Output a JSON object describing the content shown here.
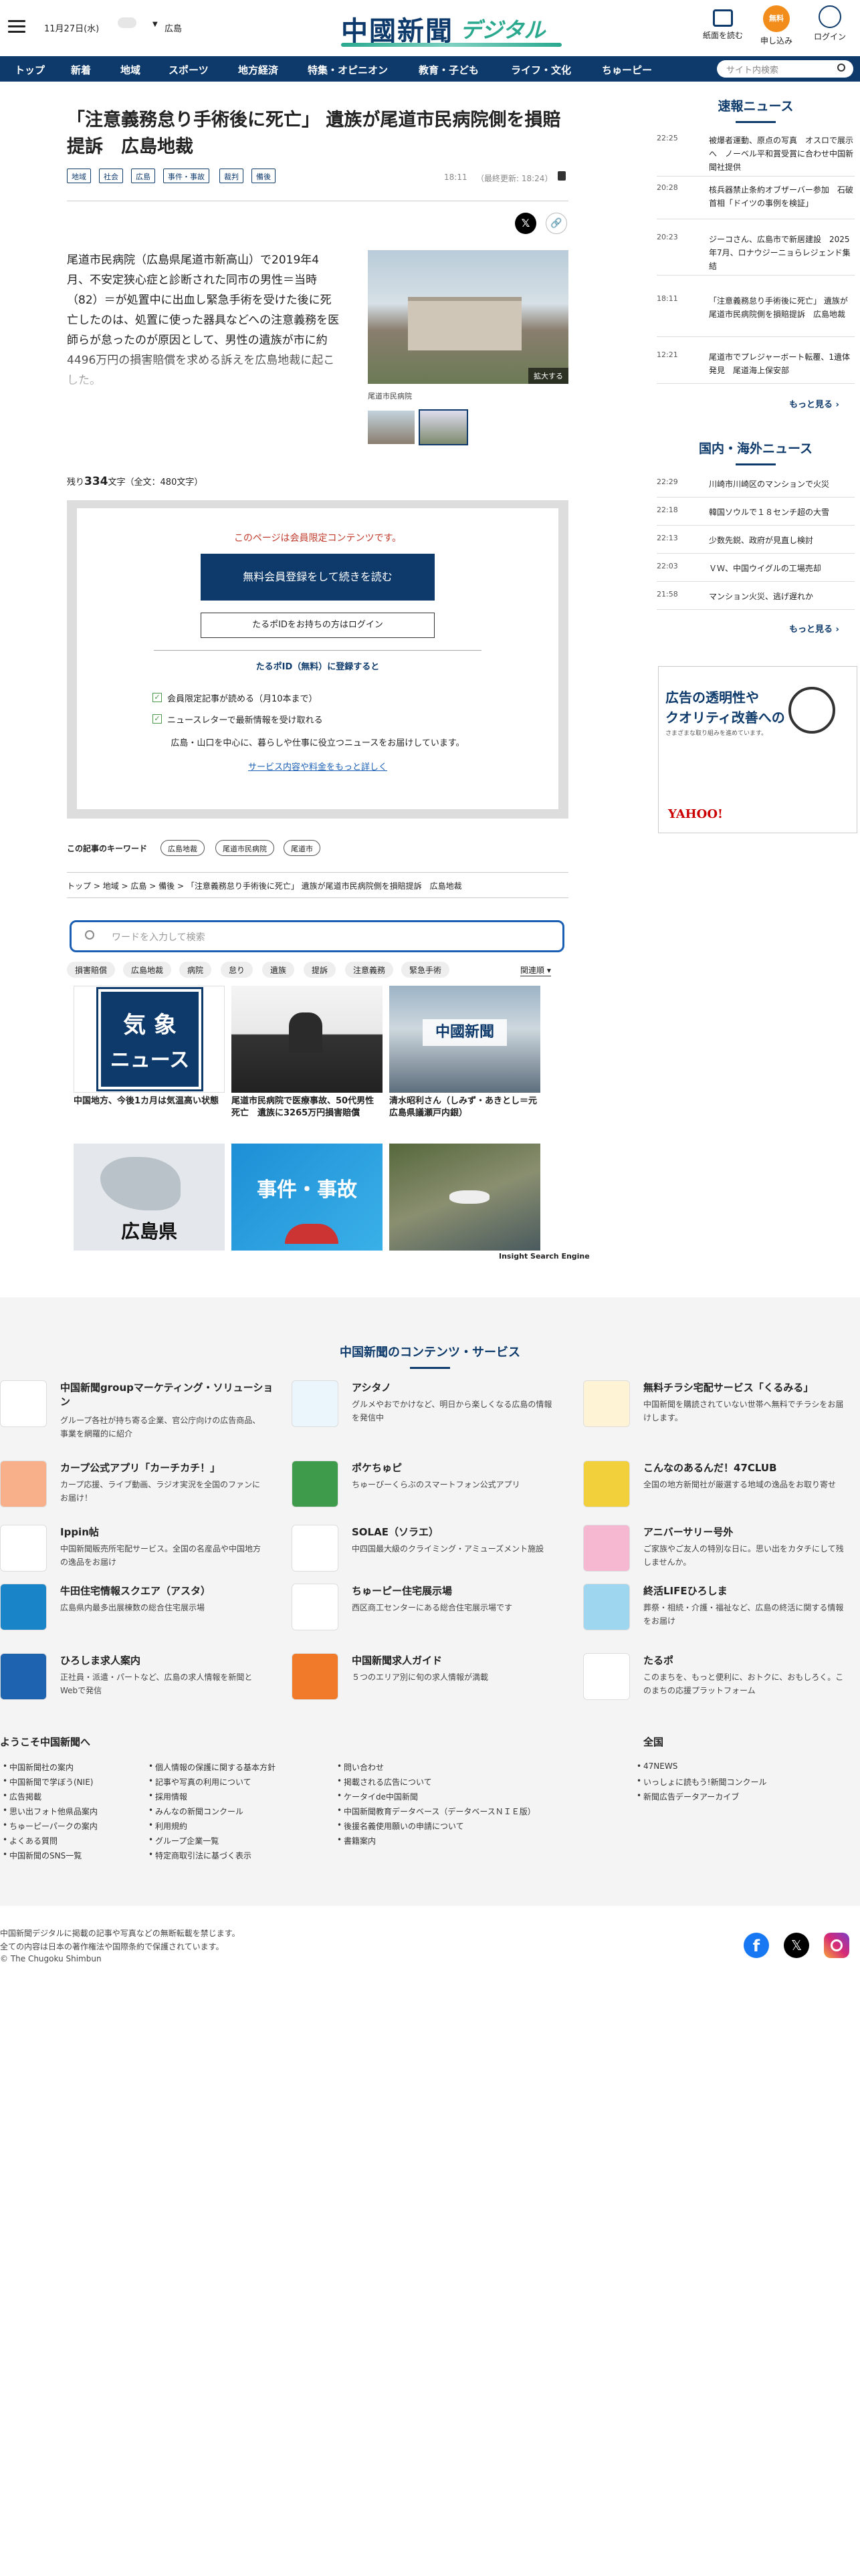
{
  "header": {
    "date": "11月27日(水)",
    "region": "広島",
    "logo_main": "中國新聞",
    "logo_sub": "デジタル",
    "buttons": [
      {
        "label": "紙面を読む",
        "icon": "newspaper-icon"
      },
      {
        "label": "申し込み",
        "icon": "free-badge-icon",
        "badge": "無料"
      },
      {
        "label": "ログイン",
        "icon": "login-icon"
      }
    ]
  },
  "nav": {
    "items": [
      "トップ",
      "新着",
      "地域",
      "スポーツ",
      "地方経済",
      "特集・オピニオン",
      "教育・子ども",
      "ライフ・文化",
      "ちゅーピー"
    ],
    "search_placeholder": "サイト内検索"
  },
  "article": {
    "title": "「注意義務怠り手術後に死亡」 遺族が尾道市民病院側を損賠提訴　広島地裁",
    "tags": [
      "地域",
      "社会",
      "広島",
      "事件・事故",
      "裁判",
      "備後"
    ],
    "time": "18:11",
    "updated": "（最終更新: 18:24）",
    "body": "尾道市民病院（広島県尾道市新高山）で2019年4月、不安定狭心症と診断された同市の男性＝当時（82）＝が処置中に出血し緊急手術を受けた後に死亡したのは、処置に使った器具などへの注意義務を医師らが怠ったのが原因として、男性の遺族が市に約4496万円の損害賠償を求める訴えを広島地裁に起こした。",
    "photo_caption": "尾道市民病院",
    "enlarge": "拡大する",
    "remaining_label": "残り",
    "remaining": "334",
    "remaining_unit": "文字",
    "total": "（全文：480文字）"
  },
  "paywall": {
    "notice": "このページは会員限定コンテンツです。",
    "register_button": "無料会員登録をして続きを読む",
    "login_button": "たるポIDをお持ちの方はログイン",
    "register_head": "たるポID（無料）に登録すると",
    "benefits": [
      "会員限定記事が読める（月10本まで）",
      "ニュースレターで最新情報を受け取れる"
    ],
    "desc": "広島・山口を中心に、暮らしや仕事に役立つニュースをお届けしています。",
    "link": "サービス内容や料金をもっと詳しく"
  },
  "keywords": {
    "label": "この記事のキーワード",
    "items": [
      "広島地裁",
      "尾道市民病院",
      "尾道市"
    ]
  },
  "breadcrumb": [
    "トップ",
    "地域",
    "広島",
    "備後",
    "「注意義務怠り手術後に死亡」 遺族が尾道市民病院側を損賠提訴　広島地裁"
  ],
  "search": {
    "placeholder": "ワードを入力して検索",
    "chips": [
      "損害賠償",
      "広島地裁",
      "病院",
      "怠り",
      "遺族",
      "提訴",
      "注意義務",
      "緊急手術"
    ],
    "sort": "関連順",
    "engine": "Insight Search Engine",
    "cards": [
      {
        "title": "中国地方、今後1カ月は気温高い状態",
        "img_text1": "気 象",
        "img_text2": "ニュース"
      },
      {
        "title": "尾道市民病院で医療事故、50代男性死亡　遺族に3265万円損害賠償",
        "img_text1": "",
        "img_text2": ""
      },
      {
        "title": "清水昭利さん（しみず・あきとし＝元広島県議瀬戸内銀）",
        "img_text1": "中國新聞",
        "img_text2": ""
      },
      {
        "title": "",
        "img_text1": "広島県",
        "img_text2": ""
      },
      {
        "title": "",
        "img_text1": "事件・事故",
        "img_text2": ""
      },
      {
        "title": "",
        "img_text1": "",
        "img_text2": ""
      }
    ]
  },
  "sidebar": {
    "flash_title": "速報ニュース",
    "flash": [
      {
        "time": "22:25",
        "text": "被爆者運動、原点の写真　オスロで展示へ　ノーベル平和賞受賞に合わせ中国新聞社提供"
      },
      {
        "time": "20:28",
        "text": "核兵器禁止条約オブザーバー参加　石破首相「ドイツの事例を検証」"
      },
      {
        "time": "20:23",
        "text": "ジーコさん、広島市で新居建設　2025年7月、ロナウジーニョらレジェンド集結"
      },
      {
        "time": "18:11",
        "text": "「注意義務怠り手術後に死亡」 遺族が尾道市民病院側を損賠提訴　広島地裁"
      },
      {
        "time": "12:21",
        "text": "尾道市でプレジャーボート転覆、1遺体発見　尾道海上保安部"
      }
    ],
    "more": "もっと見る",
    "world_title": "国内・海外ニュース",
    "world": [
      {
        "time": "22:29",
        "text": "川崎市川崎区のマンションで火災"
      },
      {
        "time": "22:18",
        "text": "韓国ソウルで１８センチ超の大雪"
      },
      {
        "time": "22:13",
        "text": "少数先鋭、政府が見直し検討"
      },
      {
        "time": "22:03",
        "text": "ＶＷ、中国ウイグルの工場売却"
      },
      {
        "time": "21:58",
        "text": "マンション火災、逃げ遅れか"
      }
    ],
    "ad_line1": "広告の透明性や",
    "ad_line2": "クオリティ改善への",
    "ad_line3": "さまざまな取り組みを進めています。",
    "ad_brand": "YAHOO!"
  },
  "services": {
    "title": "中国新聞のコンテンツ・サービス",
    "items": [
      {
        "name": "中国新聞groupマーケティング・ソリューション",
        "desc": "グループ各社が持ち寄る企業、官公庁向けの広告商品、事業を網羅的に紹介",
        "color": "#ffffff"
      },
      {
        "name": "アシタノ",
        "desc": "グルメやおでかけなど、明日から楽しくなる広島の情報を発信中",
        "color": "#eaf6fb"
      },
      {
        "name": "無料チラシ宅配サービス「くるみる」",
        "desc": "中国新聞を購読されていない世帯へ無料でチラシをお届けします。",
        "color": "#fff3d6"
      },
      {
        "name": "カープ公式アプリ「カーチカチ！」",
        "desc": "カープ応援、ライブ動画、ラジオ実況を全国のファンにお届け！",
        "color": "#f7b08a"
      },
      {
        "name": "ポケちゅピ",
        "desc": "ちゅーぴーくらぶのスマートフォン公式アプリ",
        "color": "#3f9b4c"
      },
      {
        "name": "こんなのあるんだ！47CLUB",
        "desc": "全国の地方新聞社が厳選する地域の逸品をお取り寄せ",
        "color": "#f2d03b"
      },
      {
        "name": "Ippin帖",
        "desc": "中国新聞販売所宅配サービス。全国の名産品や中国地方の逸品をお届け",
        "color": "#ffffff"
      },
      {
        "name": "SOLAE（ソラエ）",
        "desc": "中四国最大級のクライミング・アミューズメント施設",
        "color": "#ffffff"
      },
      {
        "name": "アニバーサリー号外",
        "desc": "ご家族やご友人の特別な日に。思い出をカタチにして残しませんか。",
        "color": "#f6b7d0"
      },
      {
        "name": "牛田住宅情報スクエア（アスタ）",
        "desc": "広島県内最多出展棟数の総合住宅展示場",
        "color": "#1a84c8"
      },
      {
        "name": "ちゅーピー住宅展示場",
        "desc": "西区商工センターにある総合住宅展示場です",
        "color": "#ffffff"
      },
      {
        "name": "終活LIFEひろしま",
        "desc": "葬祭・相続・介護・福祉など、広島の終活に関する情報をお届け",
        "color": "#9fd6ef"
      },
      {
        "name": "ひろしま求人案内",
        "desc": "正社員・派遣・パートなど、広島の求人情報を新聞とWebで発信",
        "color": "#1e63b0"
      },
      {
        "name": "中国新聞求人ガイド",
        "desc": "５つのエリア別に旬の求人情報が満載",
        "color": "#f07a2a"
      },
      {
        "name": "たるポ",
        "desc": "このまちを、もっと便利に、おトクに、おもしろく。このまちの応援プラットフォーム",
        "color": "#ffffff"
      }
    ]
  },
  "footer": {
    "welcome": "ようこそ中国新聞へ",
    "col1": [
      "中国新聞社の案内",
      "中国新聞で学ぼう(NIE)",
      "広告掲載",
      "思い出フォト他県品案内",
      "ちゅーピーパークの案内",
      "よくある質問",
      "中国新聞のSNS一覧"
    ],
    "col2": [
      "個人情報の保護に関する基本方針",
      "記事や写真の利用について",
      "採用情報",
      "みんなの新聞コンクール",
      "利用規約",
      "グループ企業一覧",
      "特定商取引法に基づく表示"
    ],
    "col3": [
      "問い合わせ",
      "掲載される広告について",
      "ケータイde中国新聞",
      "中国新聞教育データベース（データベースＮＩＥ版）",
      "後援名義使用願いの申請について",
      "書籍案内"
    ],
    "national": "全国",
    "col4": [
      "47NEWS",
      "いっしょに読もう!新聞コンクール",
      "新聞広告データアーカイブ"
    ],
    "copy1": "中国新聞デジタルに掲載の記事や写真などの無断転載を禁じます。",
    "copy2": "全ての内容は日本の著作権法や国際条約で保護されています。",
    "copy3": "© The Chugoku Shimbun"
  }
}
